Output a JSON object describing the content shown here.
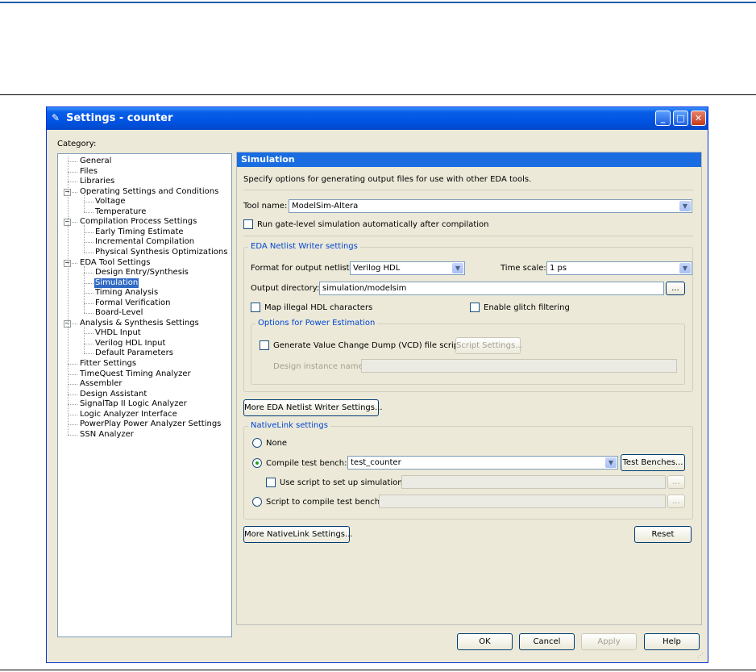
{
  "window": {
    "title": "Settings - counter",
    "minimize_symbol": "_",
    "maximize_symbol": "□",
    "close_symbol": "✕"
  },
  "category_label": "Category:",
  "tree": [
    {
      "label": "General",
      "level": 0
    },
    {
      "label": "Files",
      "level": 0
    },
    {
      "label": "Libraries",
      "level": 0
    },
    {
      "label": "Operating Settings and Conditions",
      "level": 0,
      "expander": "−"
    },
    {
      "label": "Voltage",
      "level": 1
    },
    {
      "label": "Temperature",
      "level": 1
    },
    {
      "label": "Compilation Process Settings",
      "level": 0,
      "expander": "−"
    },
    {
      "label": "Early Timing Estimate",
      "level": 1
    },
    {
      "label": "Incremental Compilation",
      "level": 1
    },
    {
      "label": "Physical Synthesis Optimizations",
      "level": 1
    },
    {
      "label": "EDA Tool Settings",
      "level": 0,
      "expander": "−"
    },
    {
      "label": "Design Entry/Synthesis",
      "level": 1
    },
    {
      "label": "Simulation",
      "level": 1,
      "selected": true
    },
    {
      "label": "Timing Analysis",
      "level": 1
    },
    {
      "label": "Formal Verification",
      "level": 1
    },
    {
      "label": "Board-Level",
      "level": 1
    },
    {
      "label": "Analysis & Synthesis Settings",
      "level": 0,
      "expander": "−"
    },
    {
      "label": "VHDL Input",
      "level": 1
    },
    {
      "label": "Verilog HDL Input",
      "level": 1
    },
    {
      "label": "Default Parameters",
      "level": 1
    },
    {
      "label": "Fitter Settings",
      "level": 0
    },
    {
      "label": "TimeQuest Timing Analyzer",
      "level": 0
    },
    {
      "label": "Assembler",
      "level": 0
    },
    {
      "label": "Design Assistant",
      "level": 0
    },
    {
      "label": "SignalTap II Logic Analyzer",
      "level": 0
    },
    {
      "label": "Logic Analyzer Interface",
      "level": 0
    },
    {
      "label": "PowerPlay Power Analyzer Settings",
      "level": 0
    },
    {
      "label": "SSN Analyzer",
      "level": 0
    }
  ],
  "panel": {
    "header": "Simulation",
    "description": "Specify options for generating output files for use with other EDA tools.",
    "tool_name_label": "Tool name:",
    "tool_name_value": "ModelSim-Altera",
    "run_gate_level_label": "Run gate-level simulation automatically after compilation",
    "run_gate_level_checked": false,
    "eda_group_title": "EDA Netlist Writer settings",
    "format_label": "Format for output netlist:",
    "format_value": "Verilog HDL",
    "time_scale_label": "Time scale:",
    "time_scale_value": "1 ps",
    "output_dir_label": "Output directory:",
    "output_dir_value": "simulation/modelsim",
    "browse_label": "...",
    "map_illegal_label": "Map illegal HDL characters",
    "map_illegal_checked": false,
    "enable_glitch_label": "Enable glitch filtering",
    "enable_glitch_checked": false,
    "power_group_title": "Options for Power Estimation",
    "vcd_label": "Generate Value Change Dump (VCD) file script",
    "vcd_checked": false,
    "script_settings_label": "Script Settings...",
    "design_instance_label": "Design instance name:",
    "design_instance_value": "",
    "more_eda_label": "More EDA Netlist Writer Settings...",
    "nativelink_group_title": "NativeLink settings",
    "none_label": "None",
    "none_selected": false,
    "compile_tb_label": "Compile test bench:",
    "compile_tb_selected": true,
    "compile_tb_value": "test_counter",
    "test_benches_label": "Test Benches...",
    "use_script_label": "Use script to set up simulation:",
    "use_script_checked": false,
    "use_script_value": "",
    "script_compile_label": "Script to compile test bench:",
    "script_compile_selected": false,
    "script_compile_value": "",
    "more_nativelink_label": "More NativeLink Settings...",
    "reset_label": "Reset"
  },
  "footer": {
    "ok_label": "OK",
    "cancel_label": "Cancel",
    "apply_label": "Apply",
    "help_label": "Help"
  }
}
